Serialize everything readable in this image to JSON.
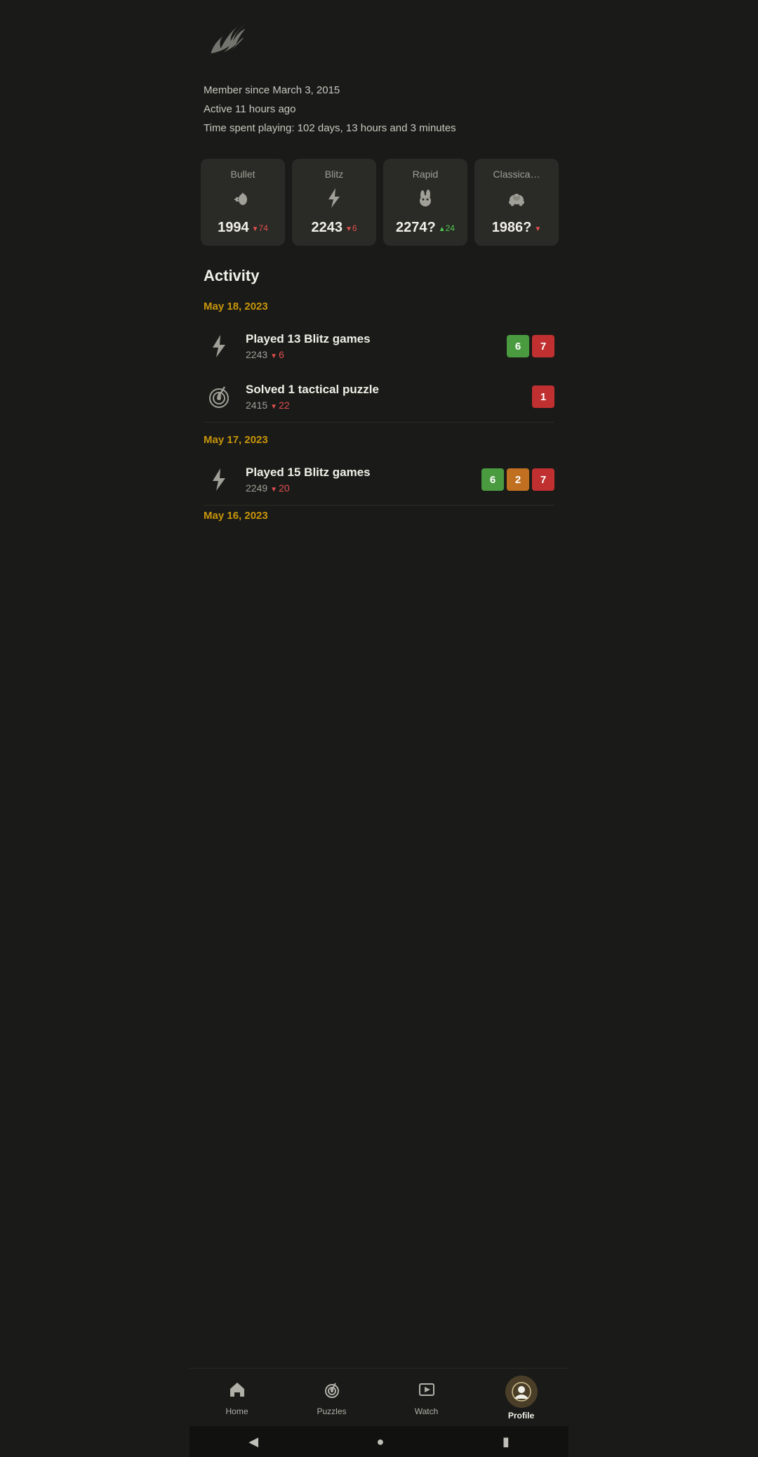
{
  "logo": {
    "alt": "Lichess logo"
  },
  "user": {
    "member_since": "Member since March 3, 2015",
    "active": "Active 11 hours ago",
    "time_spent": "Time spent playing: 102 days, 13 hours and 3 minutes"
  },
  "ratings": [
    {
      "label": "Bullet",
      "icon": "bullet",
      "value": "1994",
      "change": "74",
      "direction": "down"
    },
    {
      "label": "Blitz",
      "icon": "blitz",
      "value": "2243",
      "change": "6",
      "direction": "down"
    },
    {
      "label": "Rapid",
      "icon": "rapid",
      "value": "2274?",
      "change": "24",
      "direction": "up"
    },
    {
      "label": "Classical",
      "icon": "classical",
      "value": "1986?",
      "change": "...",
      "direction": "down"
    }
  ],
  "activity": {
    "section_title": "Activity",
    "dates": [
      {
        "date": "May 18, 2023",
        "items": [
          {
            "type": "blitz",
            "title": "Played 13 Blitz games",
            "rating": "2243",
            "change": "6",
            "direction": "down",
            "badges": [
              {
                "value": "6",
                "color": "green"
              },
              {
                "value": "7",
                "color": "red"
              }
            ]
          },
          {
            "type": "puzzle",
            "title": "Solved 1 tactical puzzle",
            "rating": "2415",
            "change": "22",
            "direction": "down",
            "badges": [
              {
                "value": "1",
                "color": "red"
              }
            ]
          }
        ]
      },
      {
        "date": "May 17, 2023",
        "items": [
          {
            "type": "blitz",
            "title": "Played 15 Blitz games",
            "rating": "2249",
            "change": "20",
            "direction": "down",
            "badges": [
              {
                "value": "6",
                "color": "green"
              },
              {
                "value": "2",
                "color": "orange"
              },
              {
                "value": "7",
                "color": "red"
              }
            ]
          }
        ]
      },
      {
        "date": "May 16, 2023",
        "items": []
      }
    ]
  },
  "nav": {
    "items": [
      {
        "label": "Home",
        "icon": "home",
        "active": false
      },
      {
        "label": "Puzzles",
        "icon": "puzzles",
        "active": false
      },
      {
        "label": "Watch",
        "icon": "watch",
        "active": false
      },
      {
        "label": "Profile",
        "icon": "profile",
        "active": true
      }
    ]
  }
}
